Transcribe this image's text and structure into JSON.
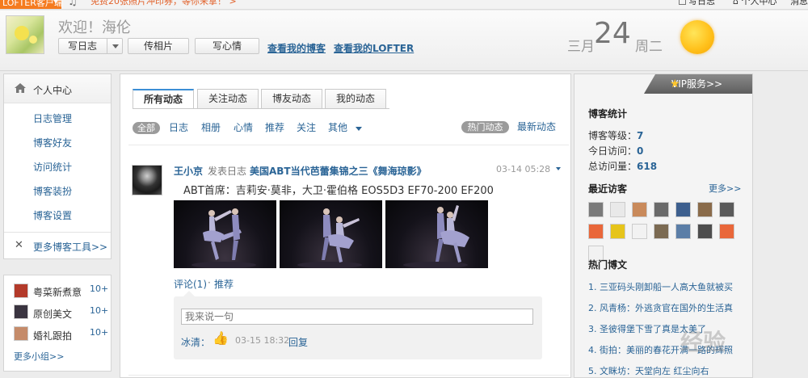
{
  "topbar": {
    "brand_label": "LOFTER客户端",
    "promo_text": "免费20张照片冲印券，等你来拿！ >",
    "write_label": "写日志",
    "home_label": "个人中心",
    "msg_label": "消息"
  },
  "header": {
    "welcome": "欢迎！海伦",
    "buttons": {
      "write": "写日志",
      "photo": "传相片",
      "mood": "写心情"
    },
    "links": {
      "my_blog": "查看我的博客",
      "my_lofter": "查看我的LOFTER"
    },
    "date": {
      "month": "三月",
      "day": "24",
      "weekday": "周二"
    },
    "weather_icon": "sun-icon"
  },
  "leftnav": {
    "head_label": "个人中心",
    "items": [
      {
        "label": "日志管理"
      },
      {
        "label": "博客好友"
      },
      {
        "label": "访问统计"
      },
      {
        "label": "博客装扮"
      },
      {
        "label": "博客设置"
      }
    ],
    "tools_label": "更多博客工具>>"
  },
  "groups": {
    "items": [
      {
        "name": "粤菜新煮意",
        "count": "10+",
        "color": "#b33a2a"
      },
      {
        "name": "原创美文",
        "count": "10+",
        "color": "#3a3440"
      },
      {
        "name": "婚礼跟拍",
        "count": "10+",
        "color": "#c58b6a"
      }
    ],
    "more_label": "更多小组>>"
  },
  "main": {
    "tabs": [
      {
        "label": "所有动态",
        "active": true
      },
      {
        "label": "关注动态"
      },
      {
        "label": "博友动态"
      },
      {
        "label": "我的动态"
      }
    ],
    "filters": {
      "all": "全部",
      "diary": "日志",
      "album": "相册",
      "mood": "心情",
      "recommend": "推荐",
      "follow": "关注",
      "other": "其他",
      "hot": "热门动态",
      "latest": "最新动态"
    },
    "post": {
      "author": "王小京",
      "action": "发表日志",
      "title": "美国ABT当代芭蕾集锦之三《舞海琼影》",
      "time": "03-14 05:28",
      "body": "ABT首席：吉莉安·莫非，大卫·霍伯格 EOS5D3 EF70-200 EF200",
      "comment_label": "评论(1)",
      "separator": "·",
      "recommend_label": "推荐",
      "comment_placeholder": "我来说一句",
      "comment": {
        "commenter": "冰清：",
        "emoji": "thumbs-up-icon",
        "time": "03-15 18:32",
        "reply_label": "回复"
      }
    }
  },
  "rightbar": {
    "vip_label": "VIP服务>>",
    "stats_title": "博客统计",
    "stats": [
      {
        "label": "博客等级：",
        "value": "7"
      },
      {
        "label": "今日访问：",
        "value": "0"
      },
      {
        "label": "总访问量：",
        "value": "618"
      }
    ],
    "visitors_title": "最近访客",
    "visitors_more": "更多>>",
    "visitor_colors": [
      "#7a7a7a",
      "#e9e9e9",
      "#c98a5b",
      "#6a6a6a",
      "#3d5f8e",
      "#8a6b4a",
      "#5a5a5a",
      "#e9673a",
      "#e6c41a",
      "#f2f2f2",
      "#7b6a52",
      "#5b7ea7",
      "#4d4d4d",
      "#e9673a",
      "#f2f2f2"
    ],
    "hot_title": "热门博文",
    "hot_posts": [
      "1. 三亚码头刚卸船一人高大鱼就被买",
      "2. 风青杨：外逃贪官在国外的生活真",
      "3. 圣彼得堡下雪了真是太美了",
      "4. 街拍：美丽的春花开满一路的辉照",
      "5. 文眯坊：天堂向左 红尘向右"
    ]
  },
  "watermark": "经验"
}
